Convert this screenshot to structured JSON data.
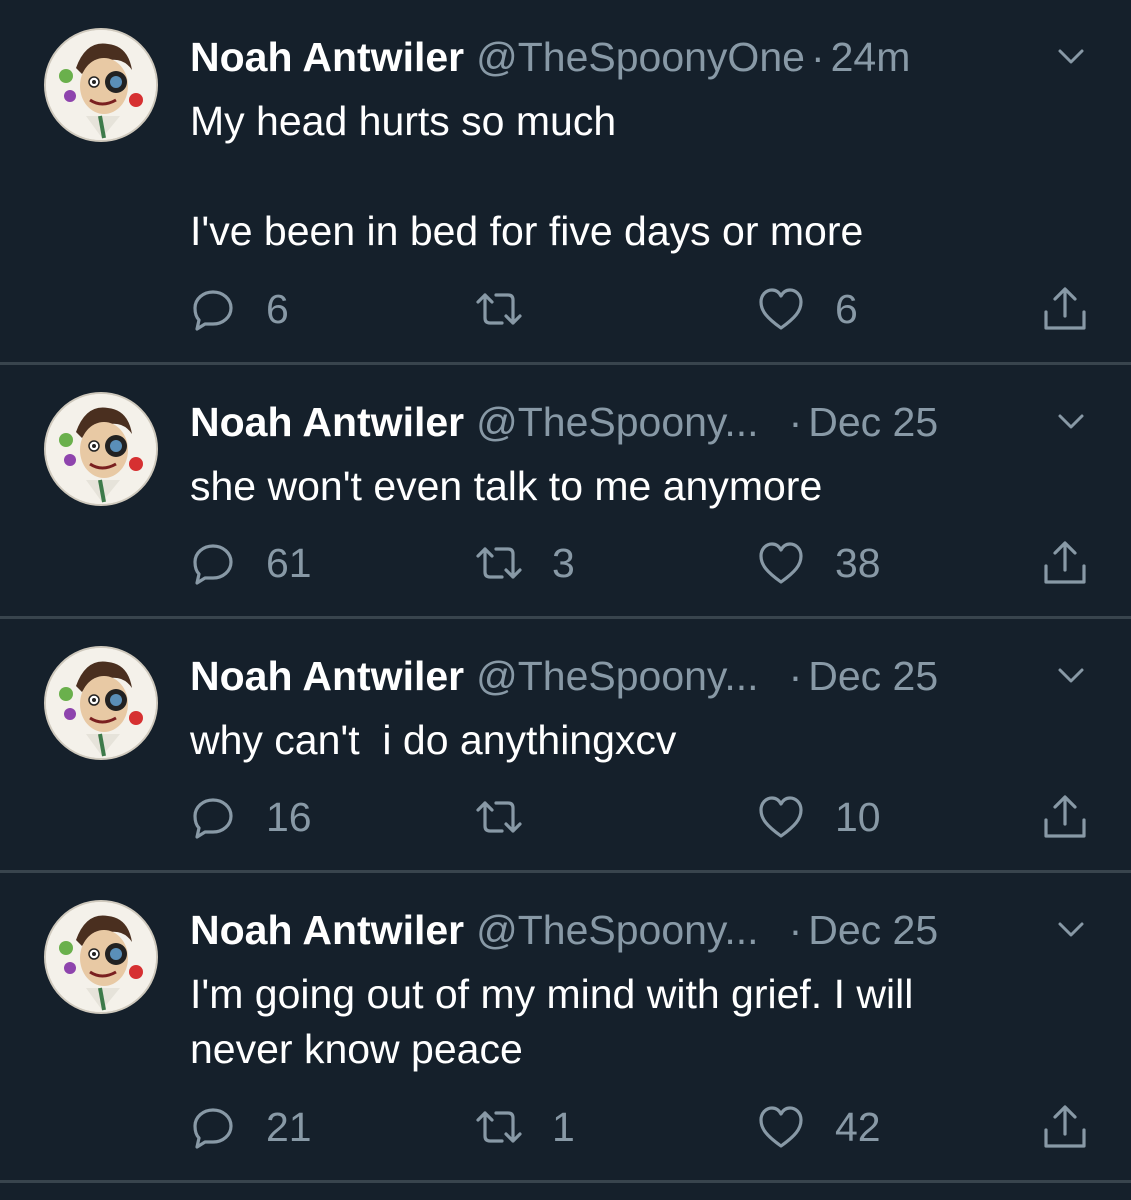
{
  "colors": {
    "background": "#15202b",
    "divider": "#38444d",
    "primary_text": "#ffffff",
    "secondary_text": "#8899a6"
  },
  "icons": {
    "reply": "reply-icon",
    "retweet": "retweet-icon",
    "like": "like-icon",
    "share": "share-icon",
    "menu": "chevron-down-icon"
  },
  "tweets": [
    {
      "name": "Noah Antwiler",
      "handle": "@TheSpoonyOne",
      "dot": "·",
      "time": "24m",
      "text": "My head hurts so much\n\nI've been in bed for five days or more",
      "replies": "6",
      "retweets": "",
      "likes": "6"
    },
    {
      "name": "Noah Antwiler",
      "handle": "@TheSpoony...",
      "dot": "·",
      "time": "Dec 25",
      "text": "she won't even talk to me anymore",
      "replies": "61",
      "retweets": "3",
      "likes": "38"
    },
    {
      "name": "Noah Antwiler",
      "handle": "@TheSpoony...",
      "dot": "·",
      "time": "Dec 25",
      "text": "why can't  i do anythingxcv",
      "replies": "16",
      "retweets": "",
      "likes": "10"
    },
    {
      "name": "Noah Antwiler",
      "handle": "@TheSpoony...",
      "dot": "·",
      "time": "Dec 25",
      "text": "I'm going out of my mind with grief. I will\nnever know peace",
      "replies": "21",
      "retweets": "1",
      "likes": "42"
    }
  ]
}
